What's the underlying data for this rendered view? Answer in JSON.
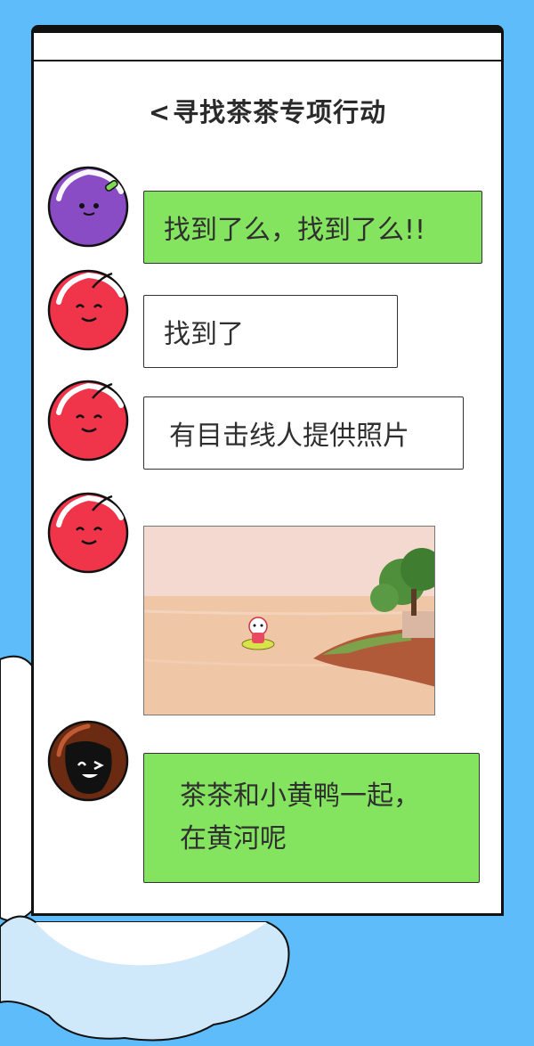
{
  "header": {
    "back_symbol": "<",
    "title": "寻找茶茶专项行动"
  },
  "messages": [
    {
      "sender": "purple-plum",
      "text": "找到了么，找到了么!!"
    },
    {
      "sender": "red-cherry",
      "text": "找到了"
    },
    {
      "sender": "red-cherry",
      "text": "有目击线人提供照片"
    },
    {
      "sender": "red-cherry",
      "type": "photo",
      "photo_subject": "cartoon mascot on a yellow duck float on a river"
    },
    {
      "sender": "brown-character",
      "lines": [
        "茶茶和小黄鸭一起，",
        "在黄河呢"
      ]
    }
  ],
  "colors": {
    "background": "#5fbcfb",
    "bubble_green": "#84e45f",
    "bubble_white": "#ffffff",
    "avatar_purple": "#8a4cc4",
    "avatar_red": "#f0344a",
    "avatar_brown": "#6b2a12"
  },
  "icons": [
    "purple-plum-avatar-icon",
    "red-cherry-avatar-icon",
    "brown-character-avatar-icon",
    "cloud-icon"
  ]
}
